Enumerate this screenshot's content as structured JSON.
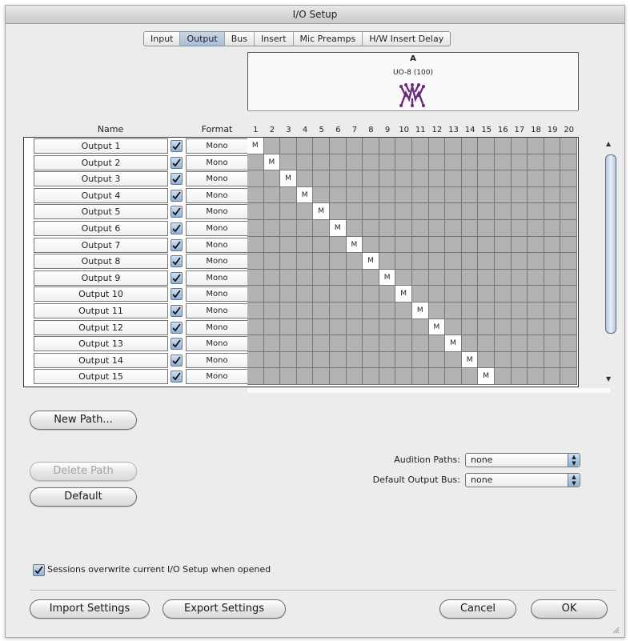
{
  "window": {
    "title": "I/O Setup"
  },
  "tabs": [
    {
      "label": "Input",
      "active": false
    },
    {
      "label": "Output",
      "active": true
    },
    {
      "label": "Bus",
      "active": false
    },
    {
      "label": "Insert",
      "active": false
    },
    {
      "label": "Mic Preamps",
      "active": false
    },
    {
      "label": "H/W Insert Delay",
      "active": false
    }
  ],
  "matrix": {
    "group_label": "A",
    "device_name": "UO-8 (100)",
    "device_icon": "io-device-icon",
    "name_header": "Name",
    "format_header": "Format",
    "channels": [
      "1",
      "2",
      "3",
      "4",
      "5",
      "6",
      "7",
      "8",
      "9",
      "10",
      "11",
      "12",
      "13",
      "14",
      "15",
      "16",
      "17",
      "18",
      "19",
      "20"
    ],
    "assign_mark": "M",
    "rows": [
      {
        "name": "Output 1",
        "enabled": true,
        "format": "Mono",
        "channel": 1
      },
      {
        "name": "Output 2",
        "enabled": true,
        "format": "Mono",
        "channel": 2
      },
      {
        "name": "Output 3",
        "enabled": true,
        "format": "Mono",
        "channel": 3
      },
      {
        "name": "Output 4",
        "enabled": true,
        "format": "Mono",
        "channel": 4
      },
      {
        "name": "Output 5",
        "enabled": true,
        "format": "Mono",
        "channel": 5
      },
      {
        "name": "Output 6",
        "enabled": true,
        "format": "Mono",
        "channel": 6
      },
      {
        "name": "Output 7",
        "enabled": true,
        "format": "Mono",
        "channel": 7
      },
      {
        "name": "Output 8",
        "enabled": true,
        "format": "Mono",
        "channel": 8
      },
      {
        "name": "Output 9",
        "enabled": true,
        "format": "Mono",
        "channel": 9
      },
      {
        "name": "Output 10",
        "enabled": true,
        "format": "Mono",
        "channel": 10
      },
      {
        "name": "Output 11",
        "enabled": true,
        "format": "Mono",
        "channel": 11
      },
      {
        "name": "Output 12",
        "enabled": true,
        "format": "Mono",
        "channel": 12
      },
      {
        "name": "Output 13",
        "enabled": true,
        "format": "Mono",
        "channel": 13
      },
      {
        "name": "Output 14",
        "enabled": true,
        "format": "Mono",
        "channel": 14
      },
      {
        "name": "Output 15",
        "enabled": true,
        "format": "Mono",
        "channel": 15
      }
    ]
  },
  "buttons": {
    "new_path": "New Path...",
    "delete_path": "Delete Path",
    "default": "Default",
    "import_settings": "Import Settings",
    "export_settings": "Export Settings",
    "cancel": "Cancel",
    "ok": "OK"
  },
  "settings": {
    "audition_paths_label": "Audition Paths:",
    "audition_paths_value": "none",
    "default_output_bus_label": "Default Output Bus:",
    "default_output_bus_value": "none",
    "sessions_overwrite_label": "Sessions overwrite current I/O Setup when opened",
    "sessions_overwrite_checked": true
  },
  "colors": {
    "grid_empty": "#b3b3b3",
    "grid_assigned": "#ffffff",
    "checkbox_accent": "#8fb1d6",
    "device_icon": "#6b2a7e"
  }
}
